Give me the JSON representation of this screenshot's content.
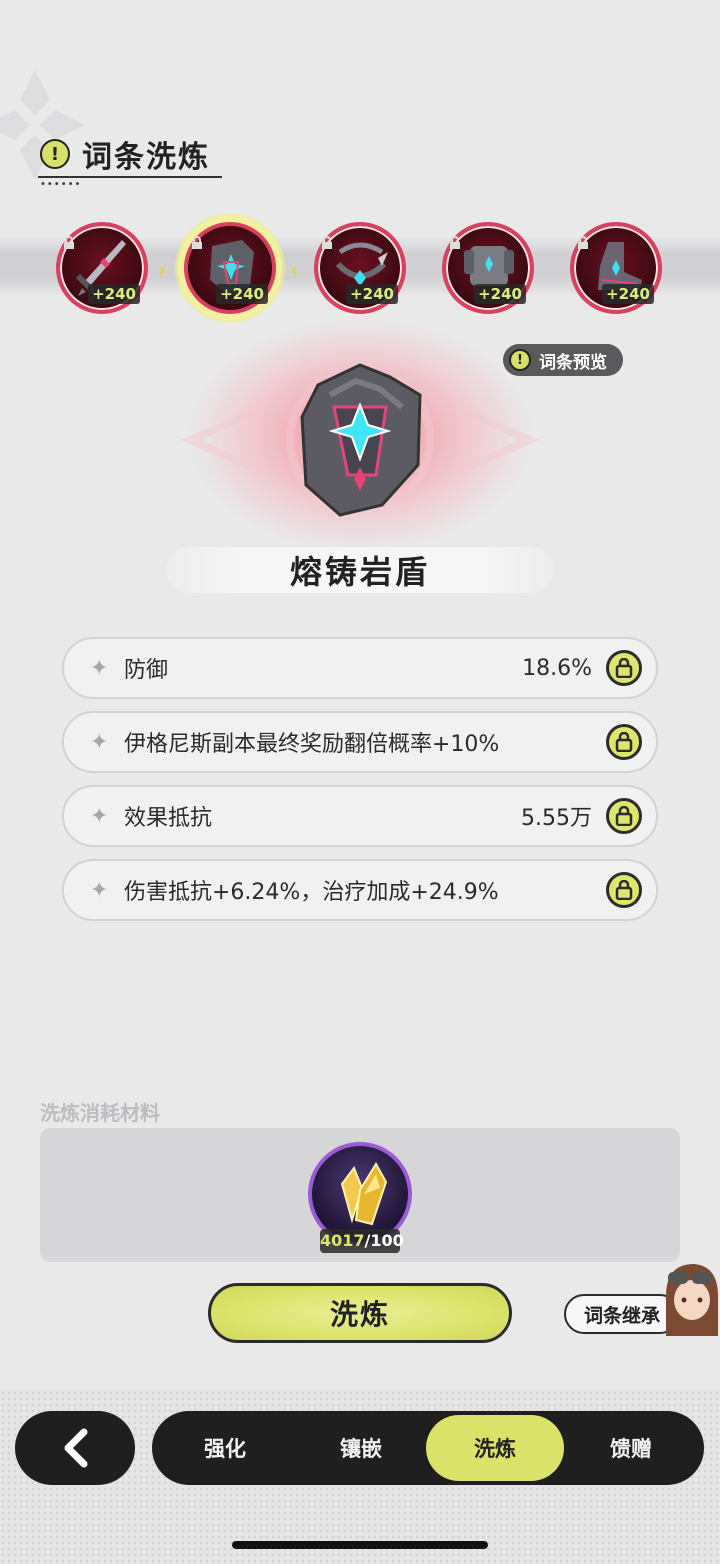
{
  "header": {
    "title": "词条洗炼",
    "icon": "alert-icon"
  },
  "equipment": [
    {
      "bonus": "+240",
      "selected": false
    },
    {
      "bonus": "+240",
      "selected": true
    },
    {
      "bonus": "+240",
      "selected": false
    },
    {
      "bonus": "+240",
      "selected": false
    },
    {
      "bonus": "+240",
      "selected": false
    }
  ],
  "preview_button": "词条预览",
  "item_name": "熔铸岩盾",
  "affixes": [
    {
      "label": "防御",
      "value": "18.6%"
    },
    {
      "label": "伊格尼斯副本最终奖励翻倍概率+10%",
      "value": ""
    },
    {
      "label": "效果抵抗",
      "value": "5.55万"
    },
    {
      "label": "伤害抵抗+6.24%，治疗加成+24.9%",
      "value": ""
    }
  ],
  "materials": {
    "title": "洗炼消耗材料",
    "have": "4017",
    "need": "/100"
  },
  "actions": {
    "wash": "洗炼",
    "inherit": "词条继承"
  },
  "tabs": [
    "强化",
    "镶嵌",
    "洗炼",
    "馈赠"
  ],
  "active_tab": "洗炼",
  "colors": {
    "accent": "#dbe26a",
    "equip_ring": "#d9405f",
    "material_ring": "#9d5ad6"
  }
}
